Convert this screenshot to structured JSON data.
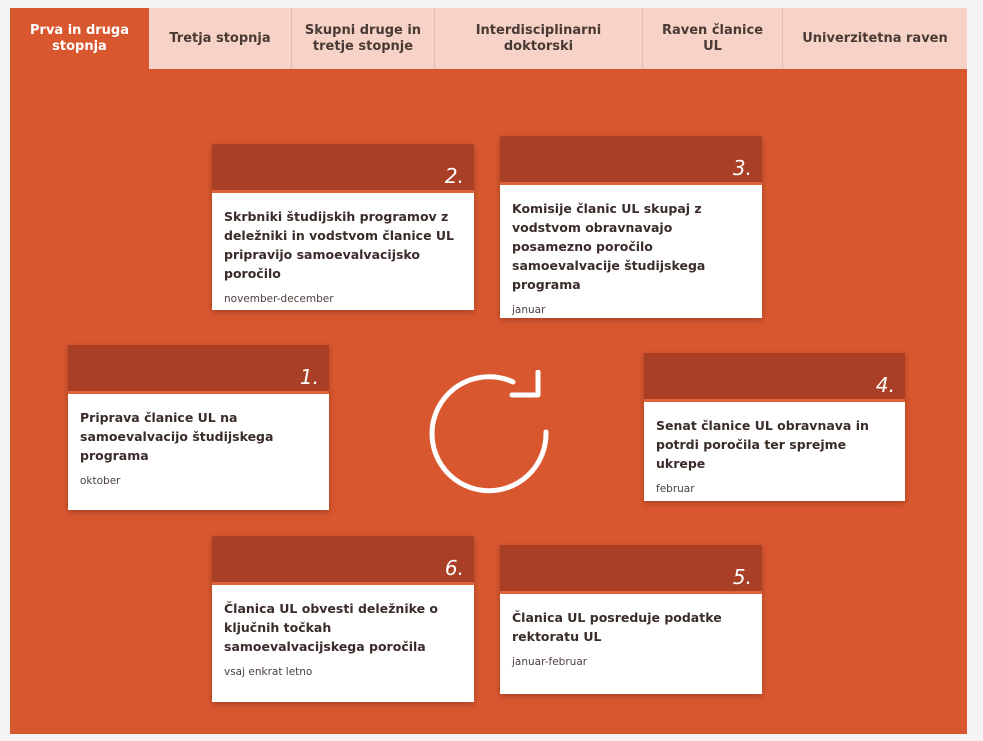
{
  "tabs": [
    {
      "label": "Prva in druga stopnja",
      "active": true
    },
    {
      "label": "Tretja stopnja",
      "active": false
    },
    {
      "label": "Skupni druge in tretje stopnje",
      "active": false
    },
    {
      "label": "Interdisciplinarni doktorski",
      "active": false
    },
    {
      "label": "Raven članice UL",
      "active": false
    },
    {
      "label": "Univerzitetna raven",
      "active": false
    }
  ],
  "steps": [
    {
      "number": "1.",
      "title": "Priprava članice UL na samoevalvacijo študijskega programa",
      "date": "oktober"
    },
    {
      "number": "2.",
      "title": "Skrbniki študijskih programov z deležniki in vodstvom članice UL pripravijo samoevalvacijsko poročilo",
      "date": "november-december"
    },
    {
      "number": "3.",
      "title": "Komisije članic UL skupaj z vodstvom obravnavajo posamezno poročilo samoevalvacije študijskega programa",
      "date": "januar"
    },
    {
      "number": "4.",
      "title": "Senat članice UL obravnava in potrdi poročila ter sprejme ukrepe",
      "date": "februar"
    },
    {
      "number": "5.",
      "title": "Članica UL posreduje podatke rektoratu UL",
      "date": "januar-februar"
    },
    {
      "number": "6.",
      "title": "Članica UL obvesti deležnike o ključnih točkah samoevalvacijskega poročila",
      "date": "vsaj enkrat letno"
    }
  ],
  "colors": {
    "background": "#d9572f",
    "card_header": "#a93f25",
    "tab_inactive": "#f6d3c6"
  },
  "center_icon": "refresh-cycle-icon"
}
